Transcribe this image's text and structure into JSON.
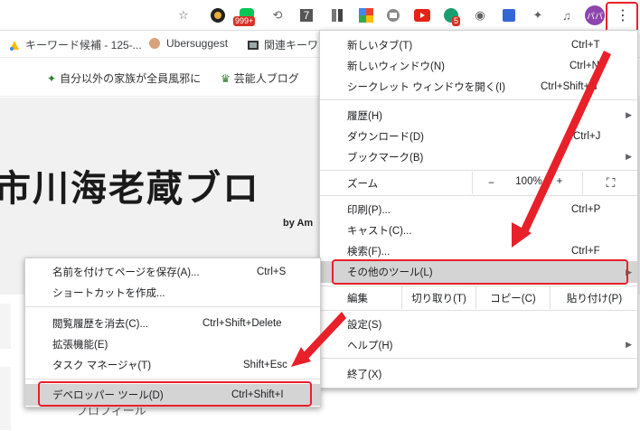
{
  "toolbar": {
    "badge_999": "999+",
    "badge_5": "5",
    "tile_7": "7",
    "avatar_text": "パパ",
    "menu_dots": "⋮"
  },
  "bookmarks": [
    {
      "label": "キーワード候補 - 125-..."
    },
    {
      "label": "Ubersuggest"
    },
    {
      "label": "関連キーワ"
    }
  ],
  "page": {
    "nav1": "自分以外の家族が全員風邪に",
    "nav2": "芸能人ブログ",
    "hero_title": "市川海老蔵ブロ",
    "hero_by": "by Am",
    "profile": "プロフィール"
  },
  "main_menu": {
    "new_tab": {
      "label": "新しいタブ(T)",
      "shortcut": "Ctrl+T"
    },
    "new_window": {
      "label": "新しいウィンドウ(N)",
      "shortcut": "Ctrl+N"
    },
    "incognito": {
      "label": "シークレット ウィンドウを開く(I)",
      "shortcut": "Ctrl+Shift+N"
    },
    "history": {
      "label": "履歴(H)"
    },
    "downloads": {
      "label": "ダウンロード(D)",
      "shortcut": "Ctrl+J"
    },
    "bookmarks": {
      "label": "ブックマーク(B)"
    },
    "zoom": {
      "label": "ズーム",
      "minus": "−",
      "value": "100%",
      "plus": "+",
      "fullscreen": "⛶"
    },
    "print": {
      "label": "印刷(P)...",
      "shortcut": "Ctrl+P"
    },
    "cast": {
      "label": "キャスト(C)..."
    },
    "find": {
      "label": "検索(F)...",
      "shortcut": "Ctrl+F"
    },
    "more_tools": {
      "label": "その他のツール(L)"
    },
    "edit": {
      "label": "編集",
      "cut": "切り取り(T)",
      "copy": "コピー(C)",
      "paste": "貼り付け(P)"
    },
    "settings": {
      "label": "設定(S)"
    },
    "help": {
      "label": "ヘルプ(H)"
    },
    "exit": {
      "label": "終了(X)"
    }
  },
  "sub_menu": {
    "save_page": {
      "label": "名前を付けてページを保存(A)...",
      "shortcut": "Ctrl+S"
    },
    "create_shortcut": {
      "label": "ショートカットを作成..."
    },
    "clear_data": {
      "label": "閲覧履歴を消去(C)...",
      "shortcut": "Ctrl+Shift+Delete"
    },
    "extensions": {
      "label": "拡張機能(E)"
    },
    "task_manager": {
      "label": "タスク マネージャ(T)",
      "shortcut": "Shift+Esc"
    },
    "dev_tools": {
      "label": "デベロッパー ツール(D)",
      "shortcut": "Ctrl+Shift+I"
    }
  },
  "colors": {
    "annotation_red": "#e8202a",
    "highlight": "#d4d4d4"
  }
}
